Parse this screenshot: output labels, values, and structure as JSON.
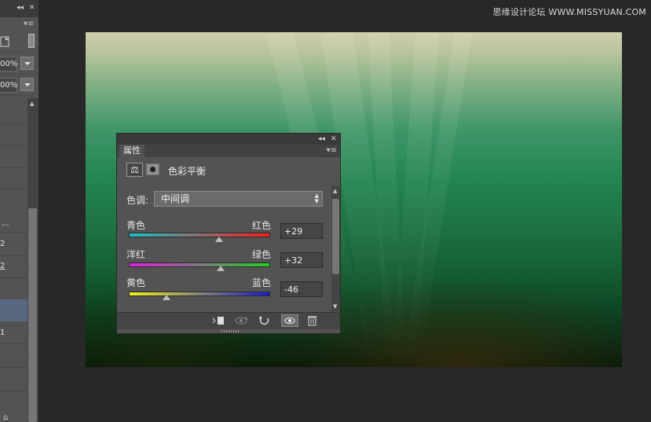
{
  "left_panel": {
    "percent_1": "00%",
    "percent_2": "00%",
    "row_labels": [
      "...",
      "2",
      "2",
      "1"
    ],
    "collapse_icon": "double-chevron-left-icon",
    "close_icon": "close-icon",
    "menu_icon": "panel-menu-icon"
  },
  "watermark": "思缘设计论坛 WWW.MISSYUAN.COM",
  "properties_panel": {
    "tab_label": "属性",
    "adjustment_title": "色彩平衡",
    "tone_label": "色调:",
    "tone_value": "中间调",
    "sliders": [
      {
        "left_label": "青色",
        "right_label": "红色",
        "value": "+29",
        "level": 29,
        "gradient": [
          "#19c3c8",
          "#ff1c1c"
        ]
      },
      {
        "left_label": "洋红",
        "right_label": "绿色",
        "value": "+32",
        "level": 32,
        "gradient": [
          "#e21ee2",
          "#1ed21e"
        ]
      },
      {
        "left_label": "黄色",
        "right_label": "蓝色",
        "value": "-46",
        "level": -46,
        "gradient": [
          "#f2f21a",
          "#1a1ad2"
        ]
      }
    ],
    "bottom_icons": [
      "clip-to-layer-icon",
      "view-previous-icon",
      "reset-icon",
      "visibility-eye-icon",
      "trash-icon"
    ]
  },
  "colors": {
    "panel_bg": "#535353",
    "app_bg": "#282828",
    "selection": "#5a6781"
  }
}
